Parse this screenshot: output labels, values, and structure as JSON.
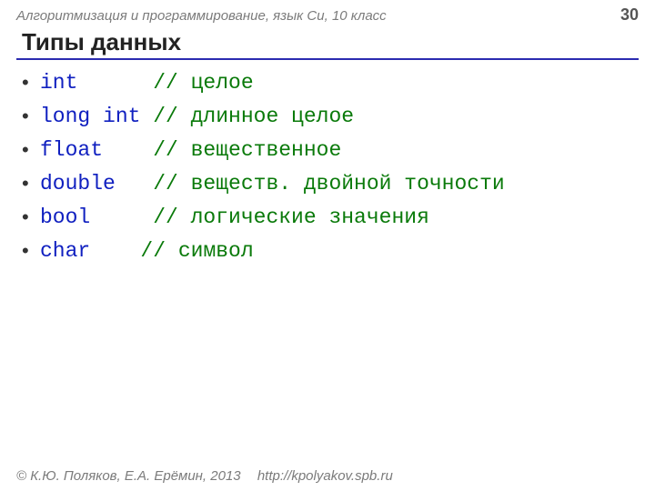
{
  "header": {
    "breadcrumb": "Алгоритмизация и программирование, язык Си, 10 класс",
    "page_number": "30"
  },
  "title": "Типы данных",
  "types": [
    {
      "keyword": "int     ",
      "comment": " // целое"
    },
    {
      "keyword": "long int",
      "comment": " // длинное целое"
    },
    {
      "keyword": "float   ",
      "comment": " // вещественное"
    },
    {
      "keyword": "double  ",
      "comment": " // веществ. двойной точности"
    },
    {
      "keyword": "bool    ",
      "comment": " // логические значения"
    },
    {
      "keyword": "char   ",
      "comment": " // символ"
    }
  ],
  "footer": {
    "copyright": "© К.Ю. Поляков, Е.А. Ерёмин, 2013",
    "url": "http://kpolyakov.spb.ru"
  }
}
